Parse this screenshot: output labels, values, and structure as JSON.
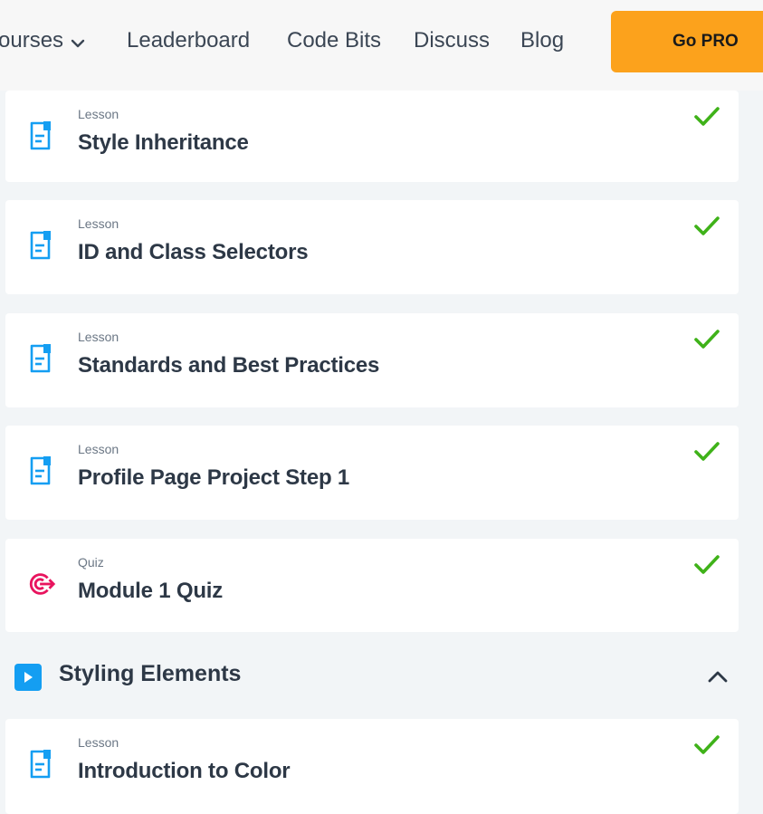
{
  "nav": {
    "courses": "ourses",
    "leaderboard": "Leaderboard",
    "code_bits": "Code Bits",
    "discuss": "Discuss",
    "blog": "Blog",
    "go_pro": "Go PRO"
  },
  "colors": {
    "accent_orange": "#fca21c",
    "lesson_icon_blue": "#149ef2",
    "quiz_icon_pink": "#e8145e",
    "check_green": "#3fb219"
  },
  "items": [
    {
      "kind": "Lesson",
      "title": "Style Inheritance",
      "icon": "lesson-document-icon",
      "completed": true
    },
    {
      "kind": "Lesson",
      "title": "ID and Class Selectors",
      "icon": "lesson-document-icon",
      "completed": true
    },
    {
      "kind": "Lesson",
      "title": "Standards and Best Practices",
      "icon": "lesson-document-icon",
      "completed": true
    },
    {
      "kind": "Lesson",
      "title": "Profile Page Project Step 1",
      "icon": "lesson-document-icon",
      "completed": true
    },
    {
      "kind": "Quiz",
      "title": "Module 1 Quiz",
      "icon": "quiz-target-icon",
      "completed": true
    }
  ],
  "section": {
    "title": "Styling Elements",
    "icon": "play-icon",
    "expanded": true
  },
  "section_items": [
    {
      "kind": "Lesson",
      "title": "Introduction to Color",
      "icon": "lesson-document-icon",
      "completed": true
    }
  ]
}
